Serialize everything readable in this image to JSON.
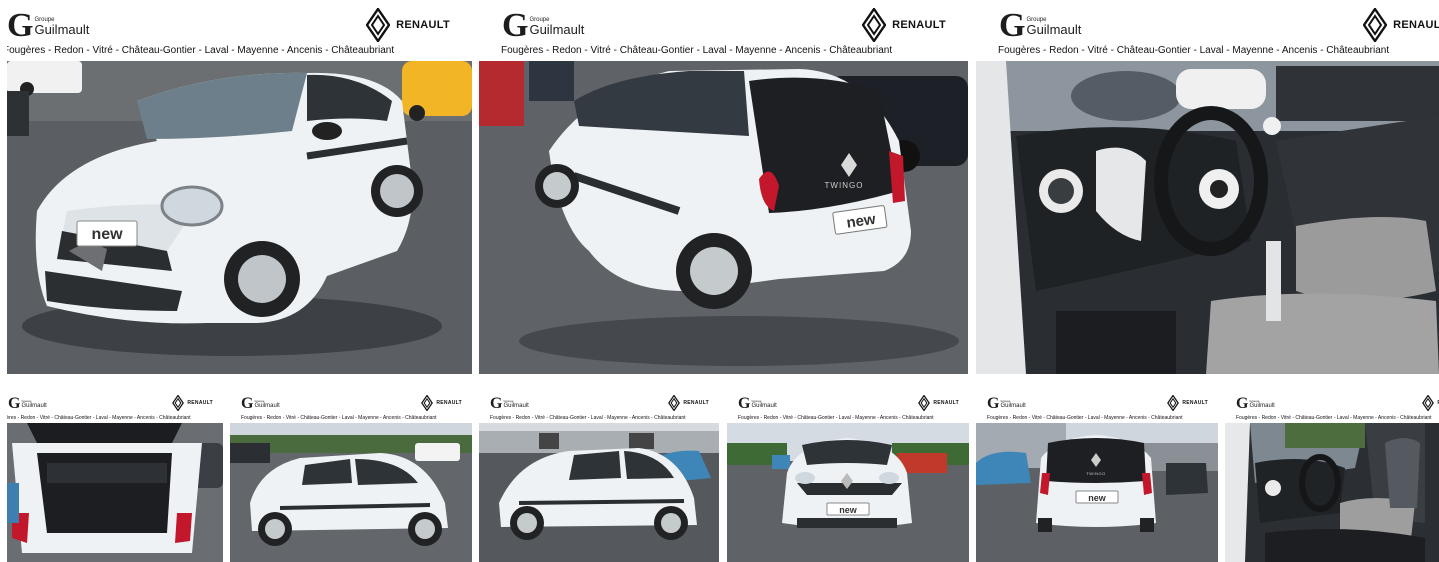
{
  "brand": {
    "logo_letter": "G",
    "groupe": "Groupe",
    "name": "Guilmault",
    "dealer": "RENAULT",
    "cities": "Fougères - Redon - Vitré - Château-Gontier - Laval - Mayenne - Ancenis - Châteaubriant"
  },
  "plate_text": "new",
  "badge_text": "TWINGO",
  "photos": [
    {
      "subject": "front-three-quarter"
    },
    {
      "subject": "rear-three-quarter"
    },
    {
      "subject": "interior-dashboard"
    },
    {
      "subject": "open-trunk"
    },
    {
      "subject": "side-left-view"
    },
    {
      "subject": "side-left-view-alt"
    },
    {
      "subject": "front-view"
    },
    {
      "subject": "rear-view"
    },
    {
      "subject": "interior-passenger-side"
    }
  ],
  "colors": {
    "car_white": "#eef2f4",
    "asphalt": "#5e6266",
    "sky": "#dfe5ec",
    "rear_black": "#1d1f22",
    "tail_red": "#c3182b",
    "interior_dark": "#2a2d31",
    "seat_check": "#9a9a9a"
  }
}
